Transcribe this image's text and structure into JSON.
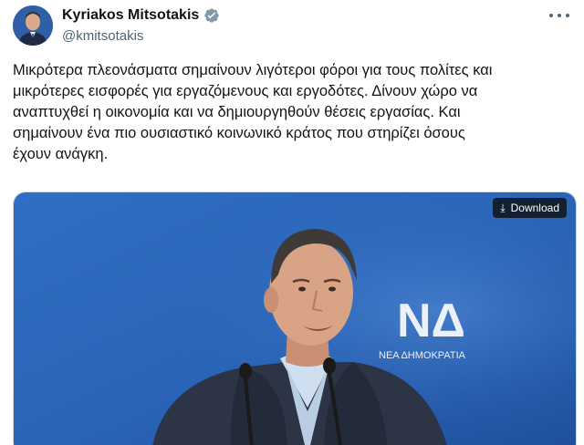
{
  "author": {
    "name": "Kyriakos Mitsotakis",
    "handle": "@kmitsotakis",
    "verified": true,
    "verified_color": "#1d9bf0"
  },
  "tweet": {
    "lines": [
      "Μικρότερα πλεονάσματα σημαίνουν λιγότεροι φόροι για τους πολίτες και",
      "μικρότερες εισφορές για εργαζόμενους και εργοδότες. Δίνουν χώρο να",
      "αναπτυχθεί η οικονομία και να δημιουργηθούν θέσεις εργασίας. Και",
      "σημαίνουν ένα πιο ουσιαστικό κοινωνικό κράτος που στηρίζει όσους",
      "έχουν ανάγκη."
    ]
  },
  "media": {
    "download_label": "Download",
    "download_icon": "download-arrow-icon",
    "backdrop_logo_text": "ΝΔ",
    "backdrop_subtext": "ΝΕΑ ΔΗΜΟΚΡΑΤΙΑ",
    "background_color": "#2a64b8"
  },
  "icons": {
    "more": "more-options-icon",
    "verified": "verified-badge-icon"
  }
}
